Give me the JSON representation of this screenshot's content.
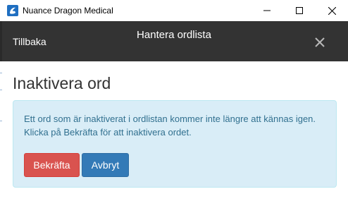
{
  "window": {
    "title": "Nuance Dragon Medical",
    "icon": "dragon-app-icon",
    "controls": [
      "minimize-icon",
      "maximize-icon",
      "close-icon"
    ]
  },
  "header": {
    "back_label": "Tillbaka",
    "title": "Hantera ordlista",
    "close_icon": "close-icon",
    "background": "#333333"
  },
  "content": {
    "heading": "Inaktivera ord",
    "alert_text": "Ett ord som är inaktiverat i ordlistan kommer inte längre att kännas igen. Klicka på Bekräfta för att inaktivera ordet.",
    "confirm_label": "Bekräfta",
    "cancel_label": "Avbryt"
  },
  "colors": {
    "alert_bg": "#d9edf7",
    "alert_text": "#31708f",
    "confirm_button": "#d9534f",
    "cancel_button": "#337ab7"
  }
}
